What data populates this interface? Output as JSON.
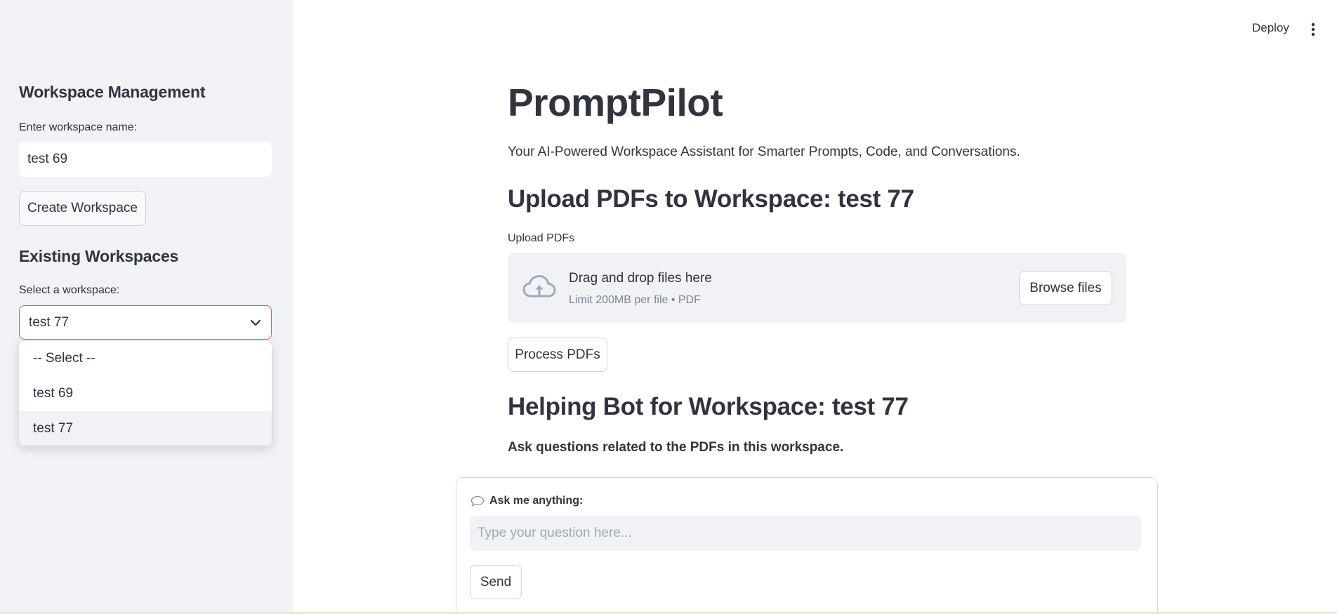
{
  "header": {
    "deploy_label": "Deploy",
    "menu_icon": "kebab-menu-icon"
  },
  "sidebar": {
    "workspace_management_heading": "Workspace Management",
    "workspace_name_label": "Enter workspace name:",
    "workspace_name_value": "test 69",
    "create_button_label": "Create Workspace",
    "existing_heading": "Existing Workspaces",
    "select_label": "Select a workspace:",
    "selected_workspace": "test 77",
    "options": [
      {
        "label": "-- Select --"
      },
      {
        "label": "test 69"
      },
      {
        "label": "test 77"
      }
    ],
    "accent_color": "#ff4b4b"
  },
  "main": {
    "title": "PromptPilot",
    "subtitle": "Your AI-Powered Workspace Assistant for Smarter Prompts, Code, and Conversations.",
    "upload_heading": "Upload PDFs to Workspace: test 77",
    "upload_label": "Upload PDFs",
    "dropzone_text": "Drag and drop files here",
    "dropzone_limit": "Limit 200MB per file • PDF",
    "browse_label": "Browse files",
    "process_label": "Process PDFs",
    "bot_heading": "Helping Bot for Workspace: test 77",
    "bot_note": "Ask questions related to the PDFs in this workspace.",
    "chat_label": "Ask me anything:",
    "chat_placeholder": "Type your question here...",
    "send_label": "Send"
  }
}
